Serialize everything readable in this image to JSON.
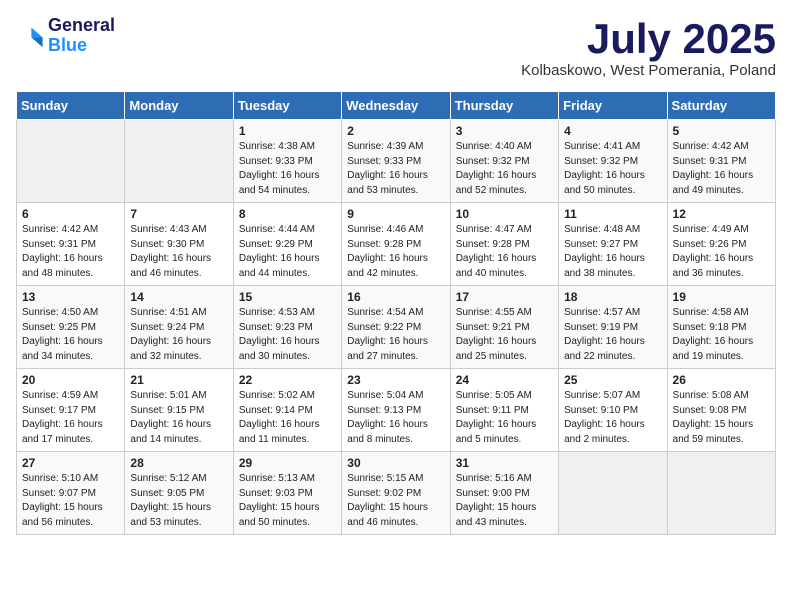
{
  "header": {
    "logo_general": "General",
    "logo_blue": "Blue",
    "month_title": "July 2025",
    "subtitle": "Kolbaskowo, West Pomerania, Poland"
  },
  "days_of_week": [
    "Sunday",
    "Monday",
    "Tuesday",
    "Wednesday",
    "Thursday",
    "Friday",
    "Saturday"
  ],
  "weeks": [
    [
      {
        "day": "",
        "info": ""
      },
      {
        "day": "",
        "info": ""
      },
      {
        "day": "1",
        "info": "Sunrise: 4:38 AM\nSunset: 9:33 PM\nDaylight: 16 hours and 54 minutes."
      },
      {
        "day": "2",
        "info": "Sunrise: 4:39 AM\nSunset: 9:33 PM\nDaylight: 16 hours and 53 minutes."
      },
      {
        "day": "3",
        "info": "Sunrise: 4:40 AM\nSunset: 9:32 PM\nDaylight: 16 hours and 52 minutes."
      },
      {
        "day": "4",
        "info": "Sunrise: 4:41 AM\nSunset: 9:32 PM\nDaylight: 16 hours and 50 minutes."
      },
      {
        "day": "5",
        "info": "Sunrise: 4:42 AM\nSunset: 9:31 PM\nDaylight: 16 hours and 49 minutes."
      }
    ],
    [
      {
        "day": "6",
        "info": "Sunrise: 4:42 AM\nSunset: 9:31 PM\nDaylight: 16 hours and 48 minutes."
      },
      {
        "day": "7",
        "info": "Sunrise: 4:43 AM\nSunset: 9:30 PM\nDaylight: 16 hours and 46 minutes."
      },
      {
        "day": "8",
        "info": "Sunrise: 4:44 AM\nSunset: 9:29 PM\nDaylight: 16 hours and 44 minutes."
      },
      {
        "day": "9",
        "info": "Sunrise: 4:46 AM\nSunset: 9:28 PM\nDaylight: 16 hours and 42 minutes."
      },
      {
        "day": "10",
        "info": "Sunrise: 4:47 AM\nSunset: 9:28 PM\nDaylight: 16 hours and 40 minutes."
      },
      {
        "day": "11",
        "info": "Sunrise: 4:48 AM\nSunset: 9:27 PM\nDaylight: 16 hours and 38 minutes."
      },
      {
        "day": "12",
        "info": "Sunrise: 4:49 AM\nSunset: 9:26 PM\nDaylight: 16 hours and 36 minutes."
      }
    ],
    [
      {
        "day": "13",
        "info": "Sunrise: 4:50 AM\nSunset: 9:25 PM\nDaylight: 16 hours and 34 minutes."
      },
      {
        "day": "14",
        "info": "Sunrise: 4:51 AM\nSunset: 9:24 PM\nDaylight: 16 hours and 32 minutes."
      },
      {
        "day": "15",
        "info": "Sunrise: 4:53 AM\nSunset: 9:23 PM\nDaylight: 16 hours and 30 minutes."
      },
      {
        "day": "16",
        "info": "Sunrise: 4:54 AM\nSunset: 9:22 PM\nDaylight: 16 hours and 27 minutes."
      },
      {
        "day": "17",
        "info": "Sunrise: 4:55 AM\nSunset: 9:21 PM\nDaylight: 16 hours and 25 minutes."
      },
      {
        "day": "18",
        "info": "Sunrise: 4:57 AM\nSunset: 9:19 PM\nDaylight: 16 hours and 22 minutes."
      },
      {
        "day": "19",
        "info": "Sunrise: 4:58 AM\nSunset: 9:18 PM\nDaylight: 16 hours and 19 minutes."
      }
    ],
    [
      {
        "day": "20",
        "info": "Sunrise: 4:59 AM\nSunset: 9:17 PM\nDaylight: 16 hours and 17 minutes."
      },
      {
        "day": "21",
        "info": "Sunrise: 5:01 AM\nSunset: 9:15 PM\nDaylight: 16 hours and 14 minutes."
      },
      {
        "day": "22",
        "info": "Sunrise: 5:02 AM\nSunset: 9:14 PM\nDaylight: 16 hours and 11 minutes."
      },
      {
        "day": "23",
        "info": "Sunrise: 5:04 AM\nSunset: 9:13 PM\nDaylight: 16 hours and 8 minutes."
      },
      {
        "day": "24",
        "info": "Sunrise: 5:05 AM\nSunset: 9:11 PM\nDaylight: 16 hours and 5 minutes."
      },
      {
        "day": "25",
        "info": "Sunrise: 5:07 AM\nSunset: 9:10 PM\nDaylight: 16 hours and 2 minutes."
      },
      {
        "day": "26",
        "info": "Sunrise: 5:08 AM\nSunset: 9:08 PM\nDaylight: 15 hours and 59 minutes."
      }
    ],
    [
      {
        "day": "27",
        "info": "Sunrise: 5:10 AM\nSunset: 9:07 PM\nDaylight: 15 hours and 56 minutes."
      },
      {
        "day": "28",
        "info": "Sunrise: 5:12 AM\nSunset: 9:05 PM\nDaylight: 15 hours and 53 minutes."
      },
      {
        "day": "29",
        "info": "Sunrise: 5:13 AM\nSunset: 9:03 PM\nDaylight: 15 hours and 50 minutes."
      },
      {
        "day": "30",
        "info": "Sunrise: 5:15 AM\nSunset: 9:02 PM\nDaylight: 15 hours and 46 minutes."
      },
      {
        "day": "31",
        "info": "Sunrise: 5:16 AM\nSunset: 9:00 PM\nDaylight: 15 hours and 43 minutes."
      },
      {
        "day": "",
        "info": ""
      },
      {
        "day": "",
        "info": ""
      }
    ]
  ]
}
